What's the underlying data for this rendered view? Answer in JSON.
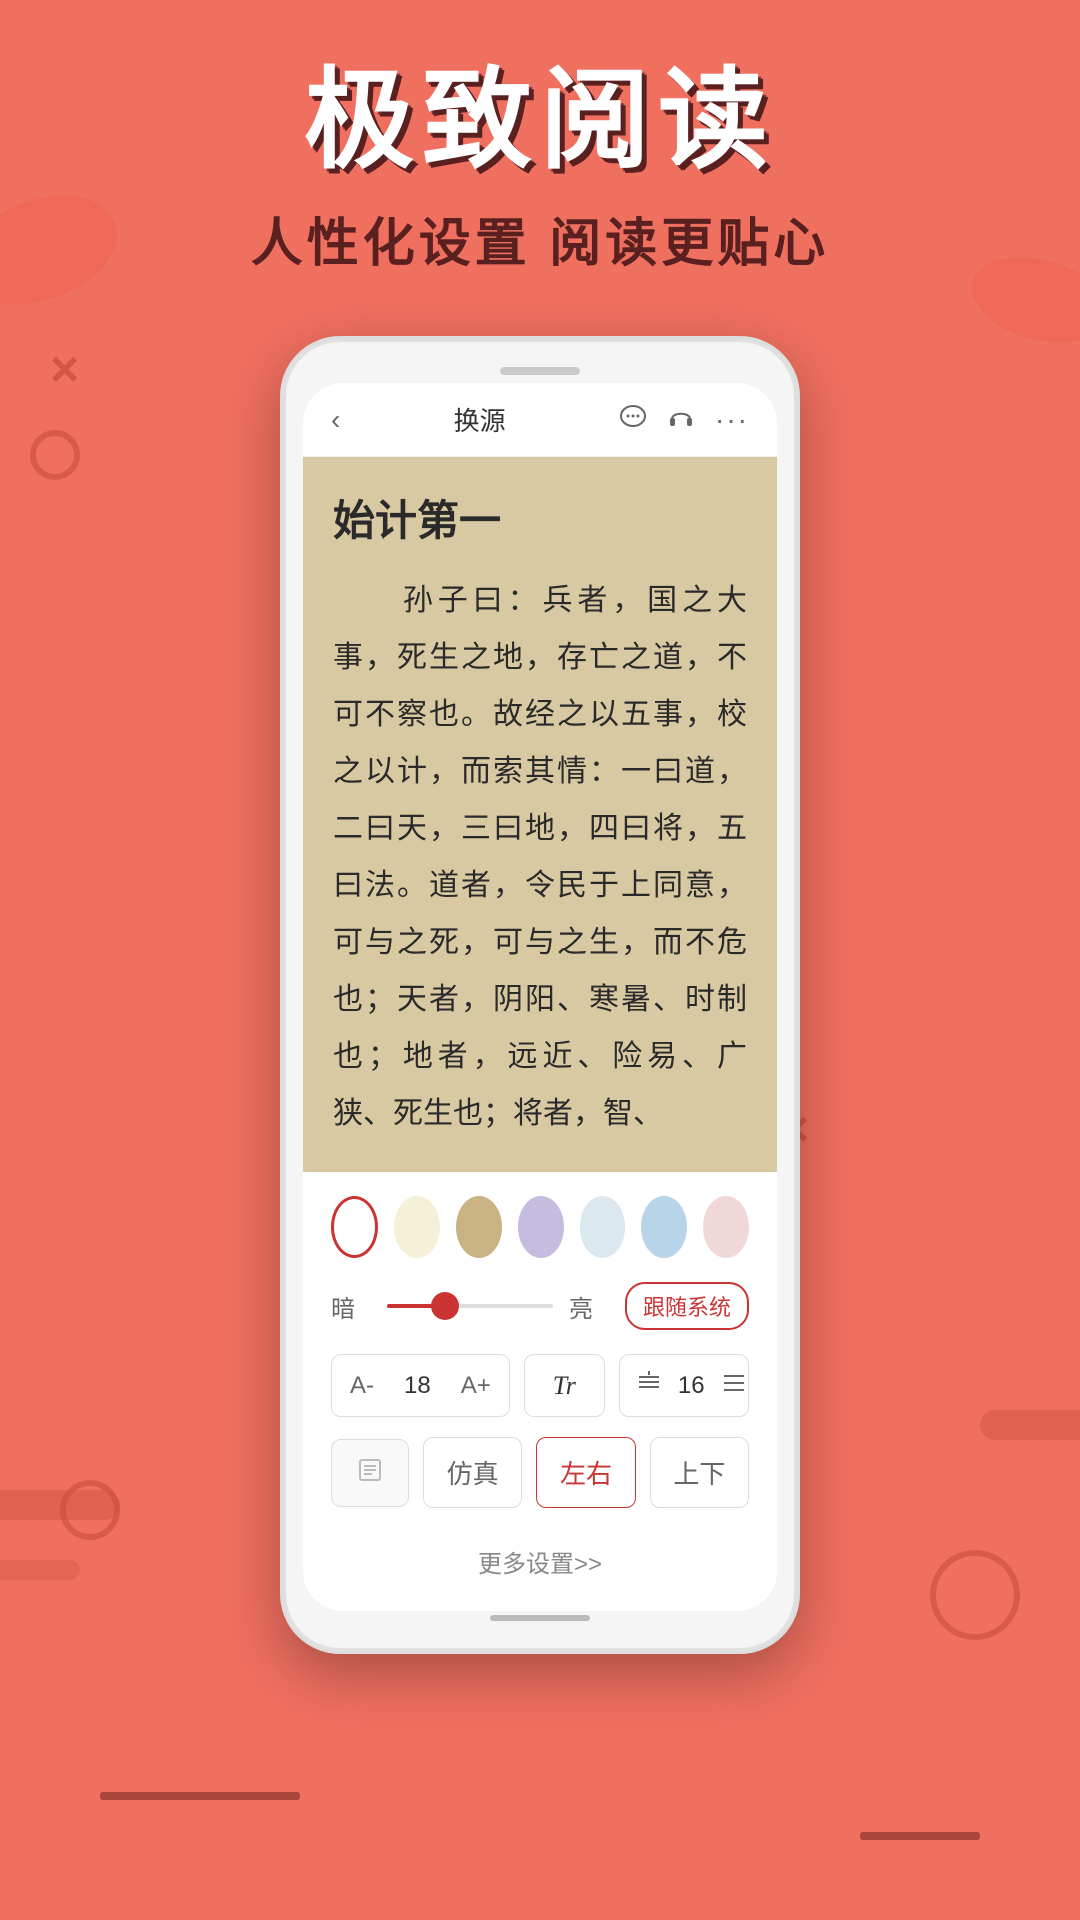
{
  "header": {
    "main_title": "极致阅读",
    "sub_title": "人性化设置  阅读更贴心"
  },
  "phone": {
    "nav": {
      "back_icon": "‹",
      "title": "换源",
      "chat_icon": "💬",
      "headphone_icon": "🎧",
      "more_icon": "···"
    },
    "book": {
      "chapter_title": "始计第一",
      "content": "　　孙子曰：兵者，国之大事，死生之地，存亡之道，不可不察也。故经之以五事，校之以计，而索其情：一曰道，二曰天，三曰地，四曰将，五曰法。道者，令民于上同意，可与之死，可与之生，而不危也；天者，阴阳、寒暑、时制也；地者，远近、险易、广狭、死生也；将者，智、"
    },
    "settings": {
      "colors": [
        {
          "name": "white",
          "hex": "#ffffff",
          "selected": true
        },
        {
          "name": "cream",
          "hex": "#f5f0d8"
        },
        {
          "name": "tan",
          "hex": "#c9b383"
        },
        {
          "name": "lavender",
          "hex": "#c5bce0"
        },
        {
          "name": "light-blue",
          "hex": "#dce8f0"
        },
        {
          "name": "sky-blue",
          "hex": "#b8d4e8"
        },
        {
          "name": "pink",
          "hex": "#f0d8d8"
        }
      ],
      "brightness": {
        "dark_label": "暗",
        "light_label": "亮",
        "system_btn": "跟随系统",
        "value": 35
      },
      "font": {
        "decrease_label": "A-",
        "size_value": "18",
        "increase_label": "A+",
        "type_label": "Tr"
      },
      "spacing": {
        "decrease_icon": "÷",
        "value": "16",
        "increase_icon": "≥"
      },
      "page_modes": [
        {
          "label": "仿真",
          "active": false
        },
        {
          "label": "左右",
          "active": true
        },
        {
          "label": "上下",
          "active": false
        }
      ],
      "more_label": "更多设置>>"
    }
  }
}
